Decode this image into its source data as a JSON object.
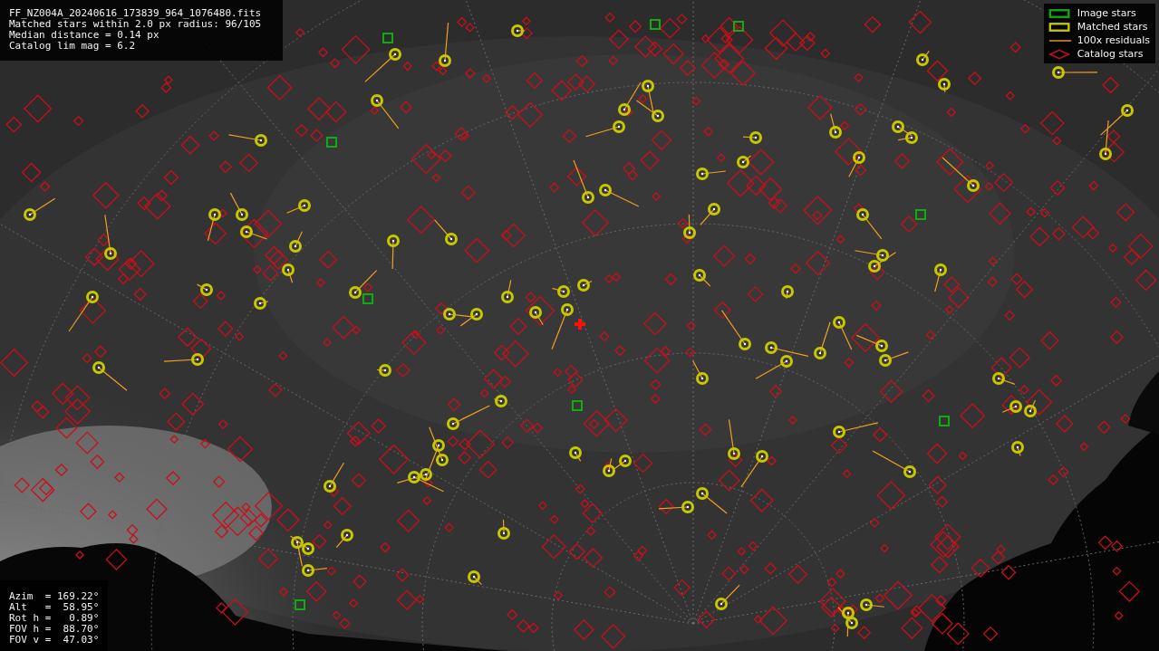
{
  "info_panel": {
    "lines": [
      "FF_NZ004A_20240616_173839_964_1076480.fits",
      "Matched stars within 2.0 px radius: 96/105",
      "Median distance = 0.14 px",
      "Catalog lim mag = 6.2"
    ]
  },
  "legend": [
    {
      "label": "Image stars"
    },
    {
      "kind": "matched",
      "label": "Matched stars"
    },
    {
      "kind": "residual",
      "label": "100x residuals"
    },
    {
      "kind": "catalog",
      "label": "Catalog stars"
    }
  ],
  "pointing_panel": {
    "lines": [
      "Azim  = 169.22°",
      "Alt   =  58.95°",
      "Rot h =   0.89°",
      "FOV h =  88.70°",
      "FOV v =  47.03°"
    ]
  }
}
